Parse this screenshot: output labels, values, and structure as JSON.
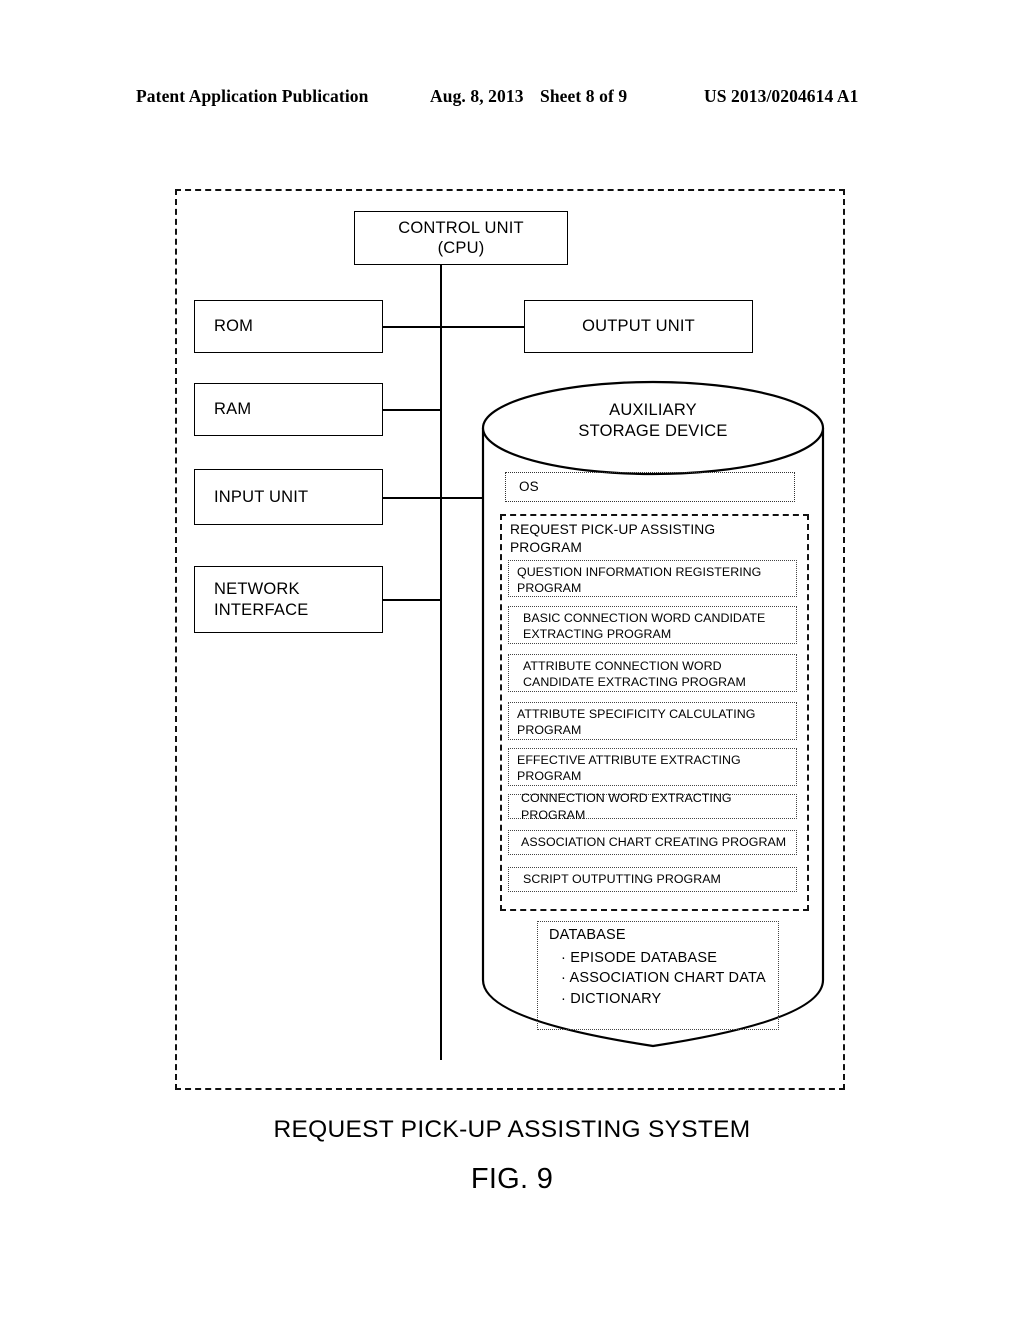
{
  "header": {
    "publication": "Patent Application Publication",
    "date": "Aug. 8, 2013",
    "sheet": "Sheet 8 of 9",
    "patent_number": "US 2013/0204614 A1"
  },
  "diagram": {
    "control_unit": "CONTROL UNIT\n(CPU)",
    "control_unit_line1": "CONTROL UNIT",
    "control_unit_line2": "(CPU)",
    "rom": "ROM",
    "ram": "RAM",
    "input_unit": "INPUT UNIT",
    "network_interface_line1": "NETWORK",
    "network_interface_line2": "INTERFACE",
    "output_unit": "OUTPUT UNIT",
    "storage": {
      "title_line1": "AUXILIARY",
      "title_line2": "STORAGE DEVICE",
      "os": "OS",
      "program_group_line1": "REQUEST PICK-UP ASSISTING",
      "program_group_line2": "PROGRAM",
      "programs": [
        "QUESTION INFORMATION REGISTERING PROGRAM",
        "BASIC CONNECTION WORD CANDIDATE EXTRACTING PROGRAM",
        "ATTRIBUTE CONNECTION WORD CANDIDATE EXTRACTING PROGRAM",
        "ATTRIBUTE SPECIFICITY CALCULATING PROGRAM",
        "EFFECTIVE ATTRIBUTE EXTRACTING PROGRAM",
        "CONNECTION WORD EXTRACTING PROGRAM",
        "ASSOCIATION CHART CREATING PROGRAM",
        "SCRIPT OUTPUTTING PROGRAM"
      ],
      "database": {
        "title": "DATABASE",
        "entries": [
          "· EPISODE DATABASE",
          "· ASSOCIATION CHART DATA",
          "· DICTIONARY"
        ]
      }
    }
  },
  "caption": {
    "system": "REQUEST PICK-UP ASSISTING SYSTEM",
    "figure": "FIG. 9"
  }
}
